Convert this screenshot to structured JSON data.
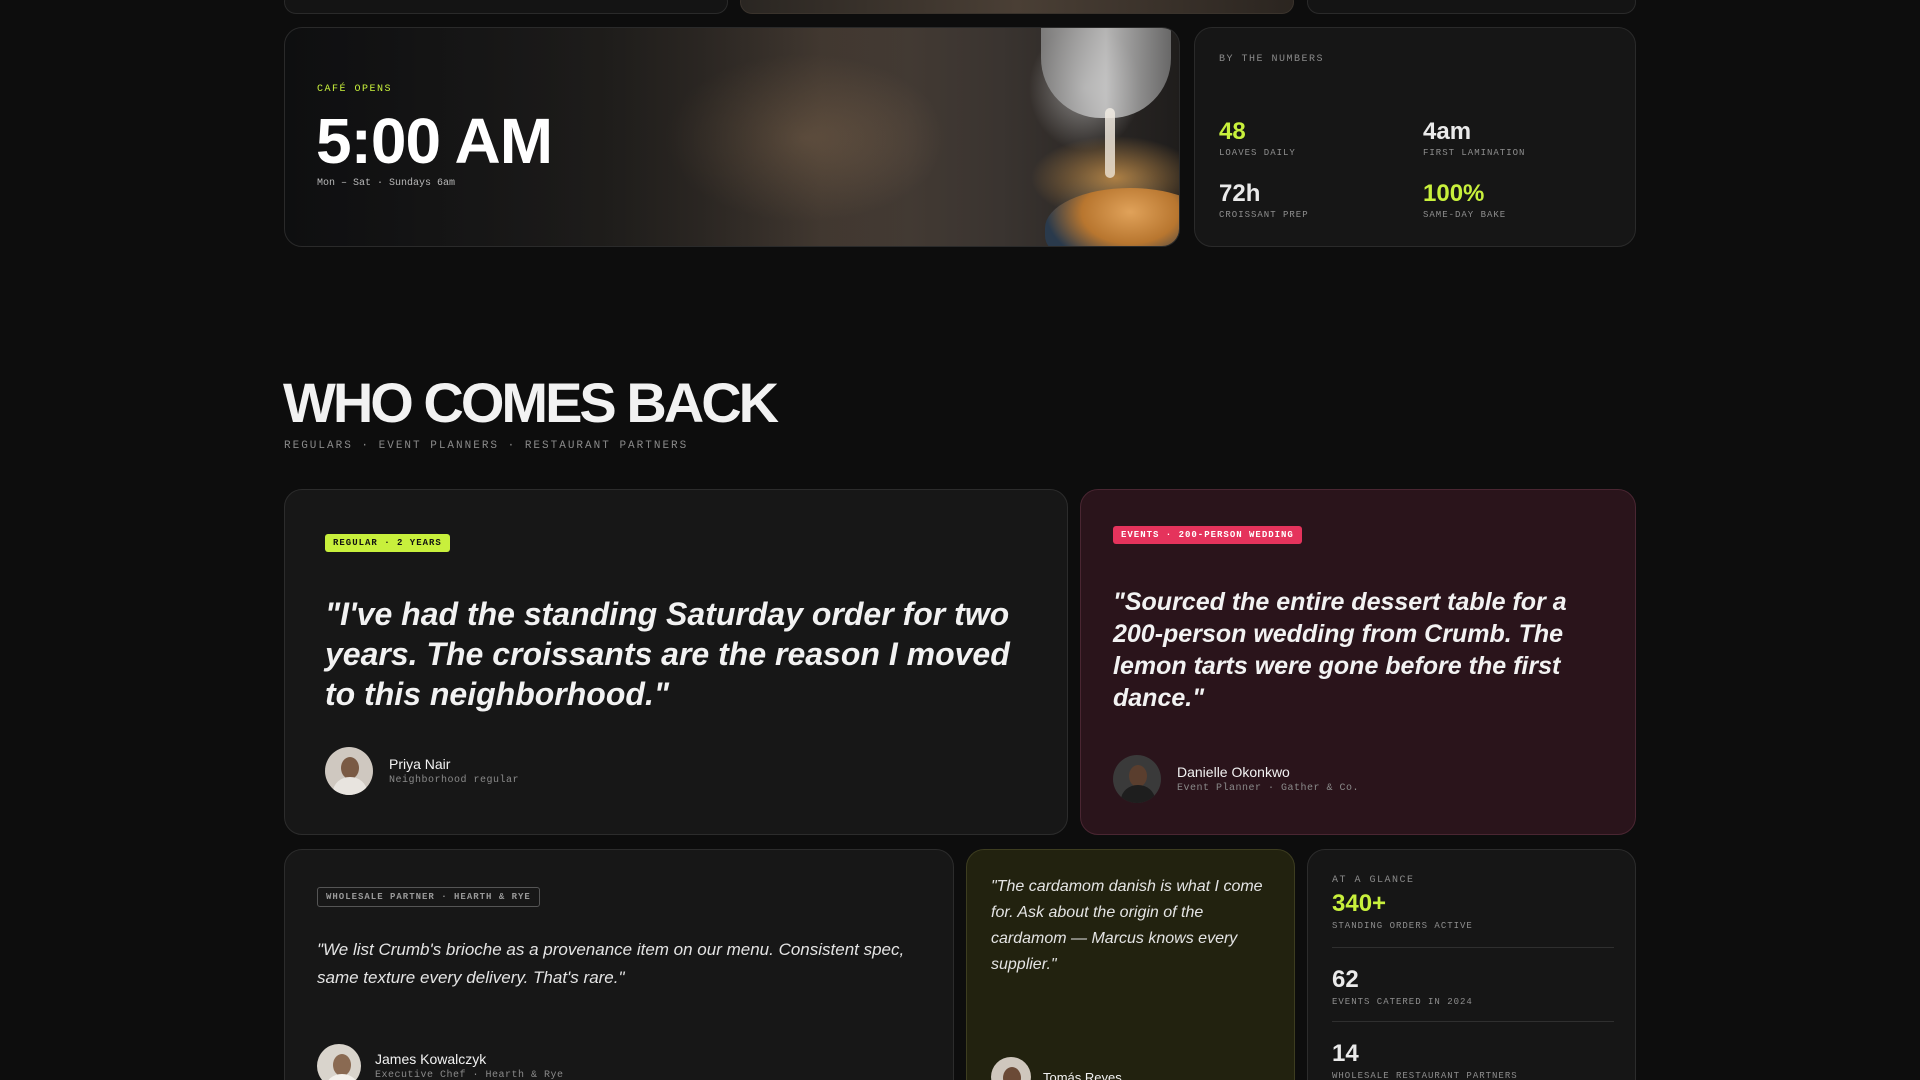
{
  "cafe": {
    "label": "CAFÉ OPENS",
    "time": "5:00 AM",
    "hours": "Mon – Sat · Sundays 6am"
  },
  "numbers": {
    "title": "BY THE NUMBERS",
    "stats": [
      {
        "value": "48",
        "label": "LOAVES DAILY",
        "accent": true
      },
      {
        "value": "4am",
        "label": "FIRST LAMINATION",
        "accent": false
      },
      {
        "value": "72h",
        "label": "CROISSANT PREP",
        "accent": false
      },
      {
        "value": "100%",
        "label": "SAME-DAY BAKE",
        "accent": true
      }
    ]
  },
  "section": {
    "title": "WHO COMES BACK",
    "subtitle": "REGULARS · EVENT PLANNERS · RESTAURANT PARTNERS"
  },
  "testimonials": {
    "regular": {
      "badge": "REGULAR · 2 YEARS",
      "quote": "\"I've had the standing Saturday order for two years. The croissants are the reason I moved to this neighborhood.\"",
      "name": "Priya Nair",
      "role": "Neighborhood regular"
    },
    "events": {
      "badge": "EVENTS · 200-PERSON WEDDING",
      "quote": "\"Sourced the entire dessert table for a 200-person wedding from Crumb. The lemon tarts were gone before the first dance.\"",
      "name": "Danielle Okonkwo",
      "role": "Event Planner · Gather & Co."
    },
    "wholesale": {
      "badge": "WHOLESALE PARTNER · HEARTH & RYE",
      "quote": "\"We list Crumb's brioche as a provenance item on our menu. Consistent spec, same texture every delivery. That's rare.\"",
      "name": "James Kowalczyk",
      "role": "Executive Chef · Hearth & Rye"
    },
    "cardamom": {
      "quote": "\"The cardamom danish is what I come for. Ask about the origin of the cardamom — Marcus knows every supplier.\"",
      "name": "Tomás Reyes"
    }
  },
  "glance": {
    "title": "AT A GLANCE",
    "stats": [
      {
        "value": "340+",
        "label": "STANDING ORDERS ACTIVE",
        "accent": true
      },
      {
        "value": "62",
        "label": "EVENTS CATERED IN 2024",
        "accent": false
      },
      {
        "value": "14",
        "label": "WHOLESALE RESTAURANT PARTNERS",
        "accent": false
      }
    ]
  },
  "colors": {
    "accent": "#c8f03c",
    "pink": "#e5335c",
    "background": "#0d0d0d"
  }
}
